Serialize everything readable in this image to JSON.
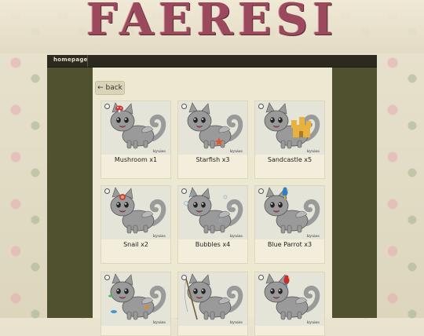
{
  "site": {
    "title": "FAERESI"
  },
  "nav": {
    "home_label": "homepage"
  },
  "back": {
    "label": "← back"
  },
  "items": [
    {
      "label": "Mushroom x1",
      "accessory": "mushroom-icon"
    },
    {
      "label": "Starfish x3",
      "accessory": "starfish-icon"
    },
    {
      "label": "Sandcastle x5",
      "accessory": "sandcastle-icon"
    },
    {
      "label": "Snail x2",
      "accessory": "snail-icon"
    },
    {
      "label": "Bubbles x4",
      "accessory": "bubbles-icon"
    },
    {
      "label": "Blue Parrot x3",
      "accessory": "blue-parrot-icon"
    },
    {
      "label": "",
      "accessory": "fish-icon"
    },
    {
      "label": "",
      "accessory": "fishing-rod-icon"
    },
    {
      "label": "",
      "accessory": "red-parrot-icon"
    }
  ],
  "creature_signature": "kyuiss",
  "colors": {
    "frame": "#50512f",
    "topbar": "#2c2a1e",
    "content": "#ece8d2",
    "card": "#f2eedb",
    "creature": "#9a9a9a",
    "title": "#9a4a5c"
  }
}
